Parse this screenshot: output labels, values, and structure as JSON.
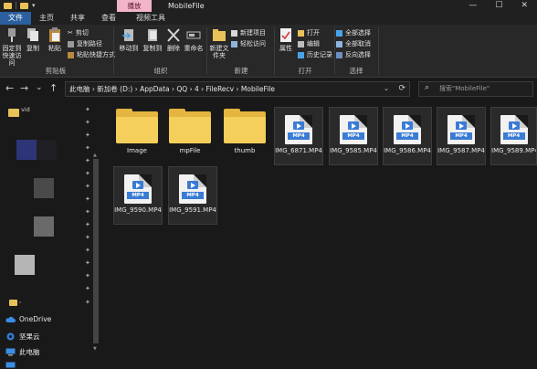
{
  "window": {
    "title": "MobileFile",
    "context_tab": "播放",
    "controls": {
      "minimize": "—",
      "maximize": "☐",
      "close": "✕"
    },
    "qa_arrow": "▾"
  },
  "tabs": [
    {
      "label": "文件"
    },
    {
      "label": "主页"
    },
    {
      "label": "共享"
    },
    {
      "label": "查看"
    },
    {
      "label": "视频工具"
    }
  ],
  "ribbon": {
    "clipboard": {
      "label": "剪贴板",
      "pin": "固定到快速访问",
      "copy": "复制",
      "paste": "粘贴",
      "cut": "剪切",
      "copy_path": "复制路径",
      "paste_shortcut": "粘贴快捷方式"
    },
    "organize": {
      "label": "组织",
      "move_to": "移动到",
      "copy_to": "复制到",
      "delete": "删除",
      "rename": "重命名"
    },
    "new": {
      "label": "新建",
      "new_folder": "新建文件夹",
      "new_item": "新建项目",
      "easy_access": "轻松访问"
    },
    "open": {
      "label": "打开",
      "properties": "属性",
      "open": "打开",
      "edit": "编辑",
      "history": "历史记录"
    },
    "select": {
      "label": "选择",
      "select_all": "全部选择",
      "select_none": "全部取消",
      "invert": "反向选择"
    }
  },
  "nav": {
    "back": "←",
    "forward": "→",
    "recent": "⌄",
    "up": "↑",
    "breadcrumbs": "此电脑 ›  新加卷 (D:)  ›  AppData  ›  QQ  ›  4        ›  FileRecv  ›  MobileFile",
    "dropdown": "⌄",
    "refresh": "⟳",
    "search_placeholder": "搜索\"MobileFile\""
  },
  "sidebar": {
    "items": [
      {
        "label": "OneDrive"
      },
      {
        "label": "坚果云"
      },
      {
        "label": "此电脑"
      }
    ],
    "folder_label_1": "vid",
    "folder_label_2": ","
  },
  "files": [
    {
      "name": "Image",
      "type": "folder"
    },
    {
      "name": "mpFile",
      "type": "folder"
    },
    {
      "name": "thumb",
      "type": "folder"
    },
    {
      "name": "IMG_6871.MP4",
      "type": "mp4"
    },
    {
      "name": "IMG_9585.MP4",
      "type": "mp4"
    },
    {
      "name": "IMG_9586.MP4",
      "type": "mp4"
    },
    {
      "name": "IMG_9587.MP4",
      "type": "mp4"
    },
    {
      "name": "IMG_9589.MP4",
      "type": "mp4"
    },
    {
      "name": "IMG_9590.MP4",
      "type": "mp4"
    },
    {
      "name": "IMG_9591.MP4",
      "type": "mp4"
    }
  ],
  "file_badge": "MP4",
  "colors": {
    "accent": "#2b5f9e",
    "context_tab": "#f1b4c8",
    "folder": "#f5cf5c",
    "mp4_blue": "#3a7bd5"
  }
}
